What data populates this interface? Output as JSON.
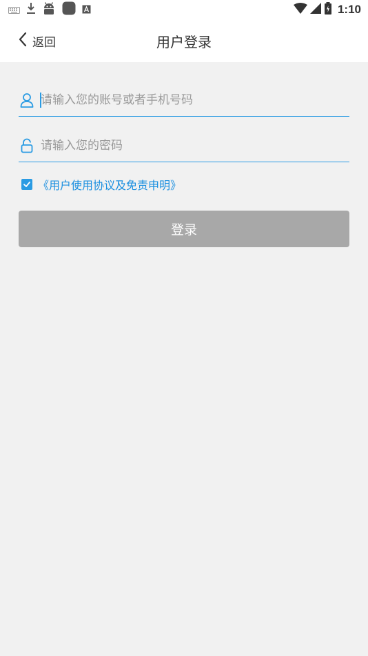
{
  "status_bar": {
    "time": "1:10",
    "left_icons": [
      "keyboard-icon",
      "download-icon",
      "android-icon",
      "app-square-icon",
      "a-box-icon"
    ],
    "right_icons": [
      "wifi-icon",
      "signal-icon",
      "battery-icon"
    ]
  },
  "header": {
    "back_label": "返回",
    "title": "用户登录"
  },
  "form": {
    "account_placeholder": "请输入您的账号或者手机号码",
    "account_value": "",
    "password_placeholder": "请输入您的密码",
    "password_value": "",
    "agreement_checked": true,
    "agreement_text": "《用户使用协议及免责申明》",
    "login_label": "登录"
  },
  "colors": {
    "accent": "#2a9be3",
    "link": "#1a8fe0",
    "button_disabled": "#a8a8a8",
    "background": "#f1f1f1"
  }
}
